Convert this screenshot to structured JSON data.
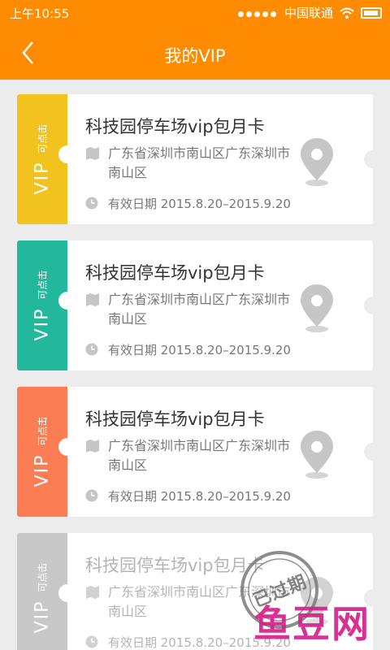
{
  "status_bar": {
    "time": "上午10:55",
    "carrier": "中国联通"
  },
  "header": {
    "title": "我的VIP",
    "back_icon": "chevron-left-icon"
  },
  "cards": [
    {
      "vip": "VIP",
      "click_hint": "可点击",
      "name": "科技园停车场vip包月卡",
      "address": "广东省深圳市南山区广东深圳市南山区",
      "validity": "有效日期 2015.8.20–2015.9.20",
      "color": "#f2c31e",
      "status": "active"
    },
    {
      "vip": "VIP",
      "click_hint": "可点击",
      "name": "科技园停车场vip包月卡",
      "address": "广东省深圳市南山区广东深圳市南山区",
      "validity": "有效日期 2015.8.20–2015.9.20",
      "color": "#23b89b",
      "status": "active"
    },
    {
      "vip": "VIP",
      "click_hint": "可点击",
      "name": "科技园停车场vip包月卡",
      "address": "广东省深圳市南山区广东深圳市南山区",
      "validity": "有效日期 2015.8.20–2015.9.20",
      "color": "#fb7d53",
      "status": "active"
    },
    {
      "vip": "VIP",
      "click_hint": "可点击",
      "name": "科技园停车场vip包月卡",
      "address": "广东省深圳市南山区广东深圳市南山区",
      "validity": "有效日期 2015.8.20–2015.9.20",
      "color": "#c8c8c8",
      "status": "expired",
      "stamp": "已过期"
    }
  ],
  "watermark": "鱼豆网",
  "colors": {
    "accent": "#ff8c00",
    "background": "#ececec"
  }
}
